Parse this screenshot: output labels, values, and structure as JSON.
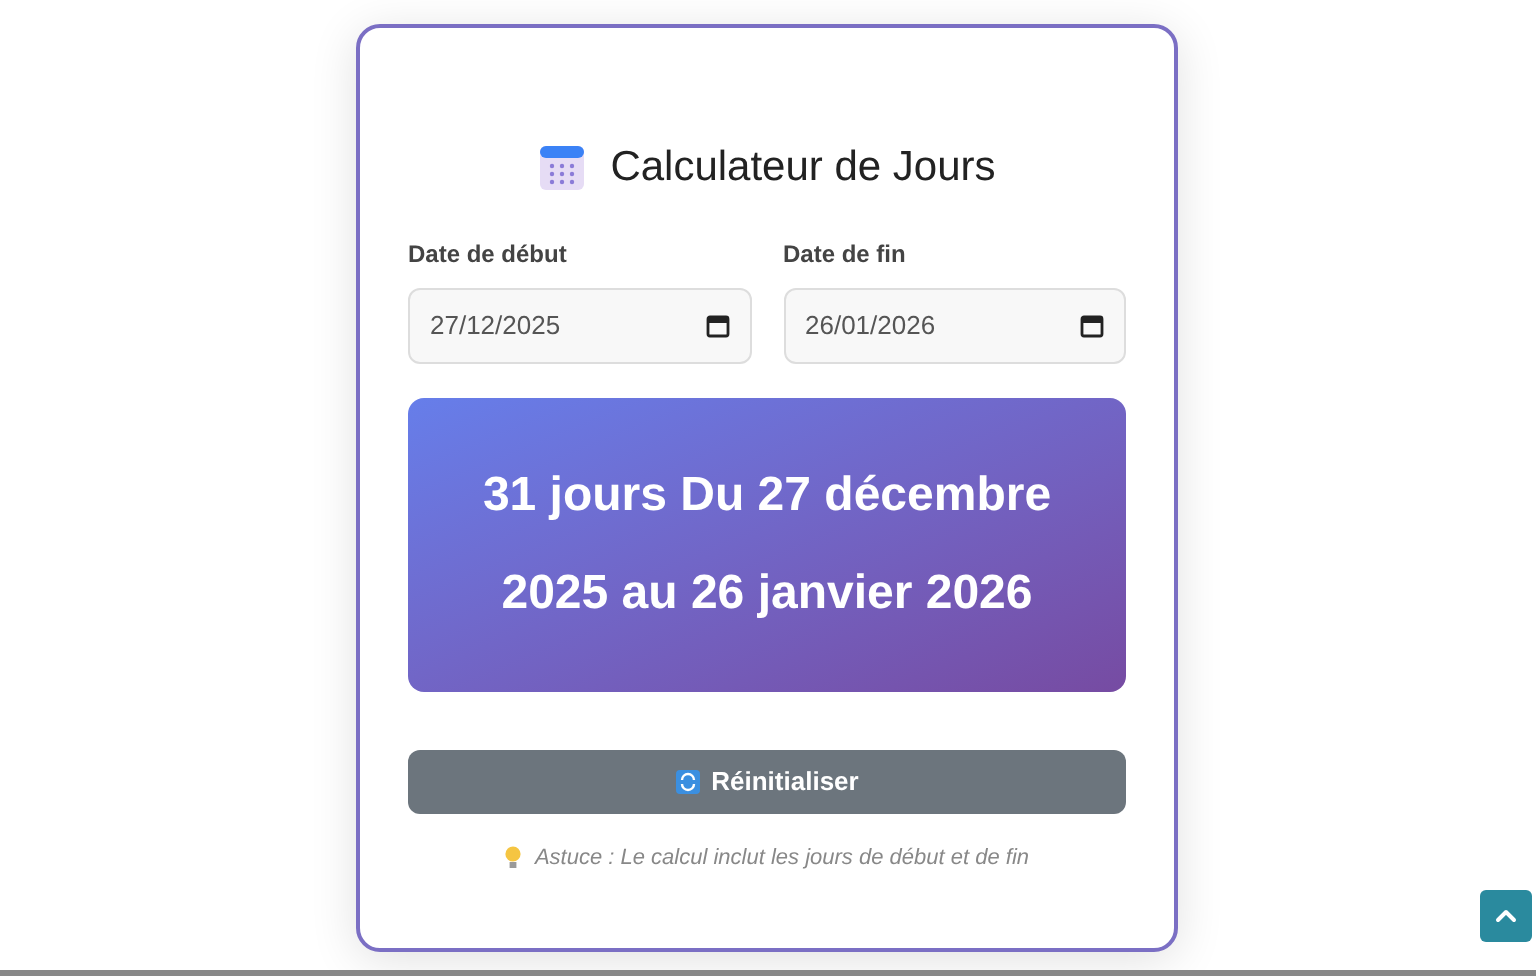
{
  "title": "Calculateur de Jours",
  "fields": [
    {
      "label": "Date de début",
      "value": "27/12/2025"
    },
    {
      "label": "Date de fin",
      "value": "26/01/2026"
    }
  ],
  "result": "31 jours Du 27 décembre 2025 au 26 janvier 2026",
  "reset_button": "Réinitialiser",
  "tip": "Astuce : Le calcul inclut les jours de début et de fin"
}
